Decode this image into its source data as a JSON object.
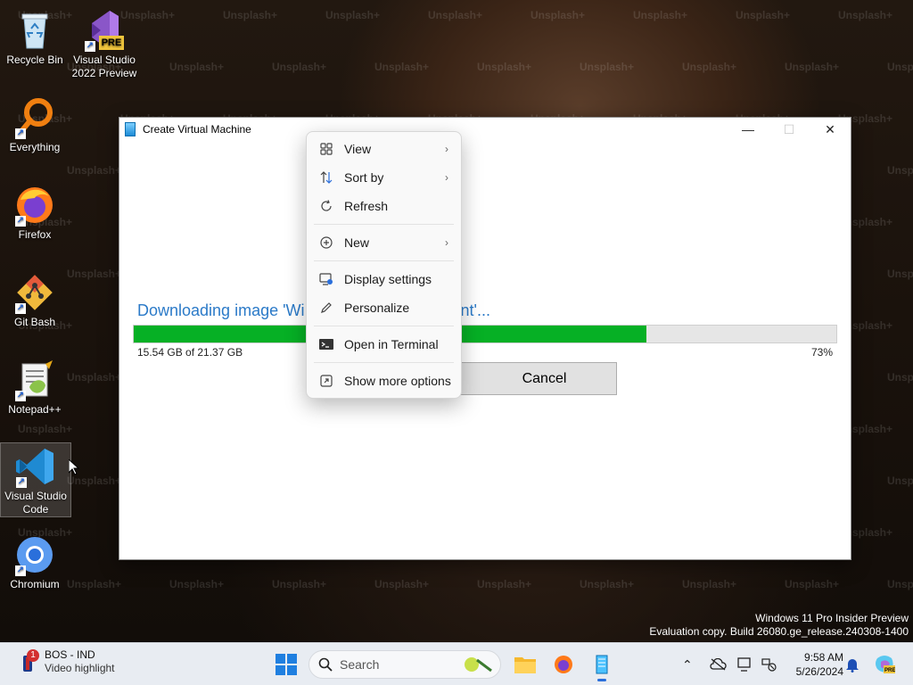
{
  "desktop": {
    "watermark_text": "Unsplash+",
    "icons": [
      {
        "label": "Recycle Bin"
      },
      {
        "label": "Visual Studio 2022 Preview",
        "badge": "PRE"
      },
      {
        "label": "Everything"
      },
      {
        "label": "Firefox"
      },
      {
        "label": "Git Bash"
      },
      {
        "label": "Notepad++"
      },
      {
        "label": "Visual Studio Code"
      },
      {
        "label": "Chromium"
      }
    ],
    "eval_line1": "Windows 11 Pro Insider Preview",
    "eval_line2": "Evaluation copy. Build 26080.ge_release.240308-1400"
  },
  "window": {
    "title": "Create Virtual Machine",
    "download_text": "Downloading image 'Wi",
    "download_text_tail": "ment'...",
    "progress_percent": 73,
    "progress_label": "73%",
    "size_text": "15.54 GB of 21.37 GB",
    "cancel_label": "Cancel",
    "minimize": "—",
    "maximize": "☐",
    "close": "✕"
  },
  "context_menu": {
    "items": [
      {
        "label": "View",
        "icon": "grid-icon",
        "submenu": true
      },
      {
        "label": "Sort by",
        "icon": "sort-icon",
        "submenu": true
      },
      {
        "label": "Refresh",
        "icon": "refresh-icon",
        "submenu": false
      },
      {
        "label": "New",
        "icon": "plus-circle-icon",
        "submenu": true
      },
      {
        "label": "Display settings",
        "icon": "display-icon",
        "submenu": false
      },
      {
        "label": "Personalize",
        "icon": "pen-icon",
        "submenu": false
      },
      {
        "label": "Open in Terminal",
        "icon": "terminal-icon",
        "submenu": false
      },
      {
        "label": "Show more options",
        "icon": "expand-icon",
        "submenu": false
      }
    ]
  },
  "taskbar": {
    "widget_title": "BOS - IND",
    "widget_sub": "Video highlight",
    "widget_badge": "1",
    "search_label": "Search",
    "time": "9:58 AM",
    "date": "5/26/2024",
    "accent": "#2a6fdb"
  }
}
